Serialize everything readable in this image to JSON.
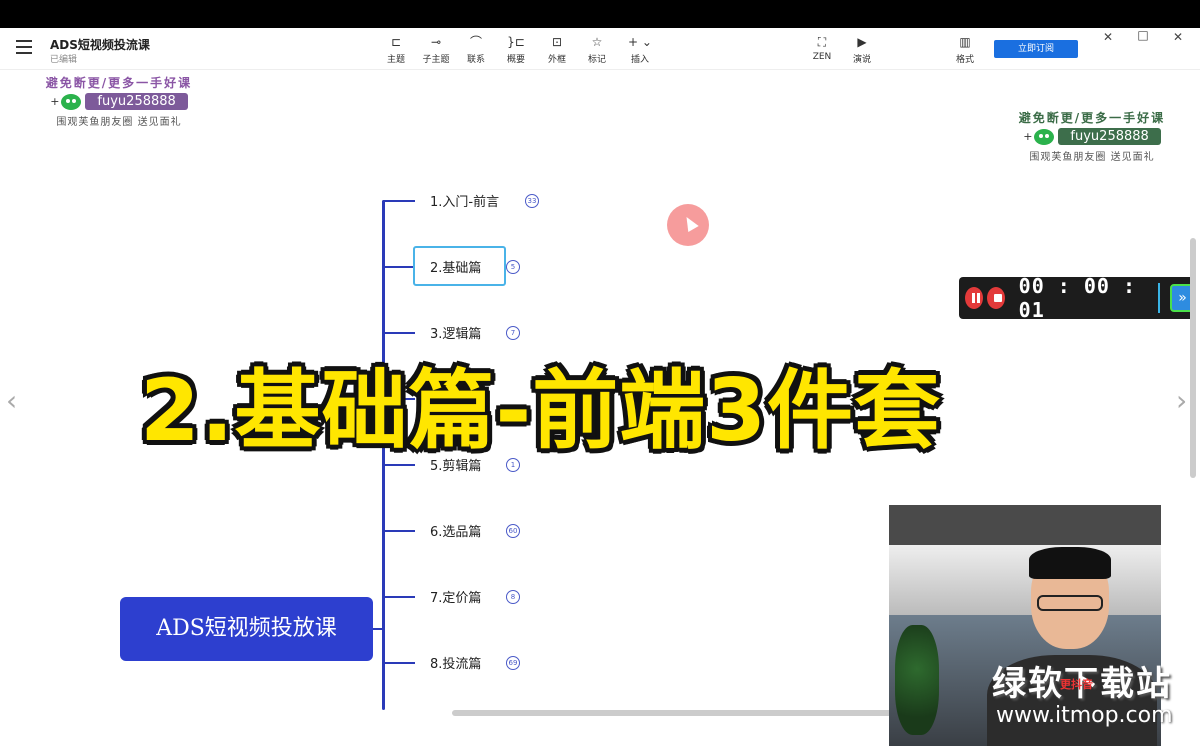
{
  "app": {
    "title": "ADS短视频投流课",
    "status": "已编辑"
  },
  "toolbar": {
    "items": [
      {
        "label": "主题",
        "icon": "topic-icon"
      },
      {
        "label": "子主题",
        "icon": "subtopic-icon"
      },
      {
        "label": "联系",
        "icon": "relation-icon"
      },
      {
        "label": "概要",
        "icon": "summary-icon"
      },
      {
        "label": "外框",
        "icon": "boundary-icon"
      },
      {
        "label": "标记",
        "icon": "marker-icon"
      },
      {
        "label": "插入",
        "icon": "insert-icon"
      },
      {
        "label": "ZEN",
        "icon": "zen-icon"
      },
      {
        "label": "演说",
        "icon": "pitch-icon"
      },
      {
        "label": "格式",
        "icon": "format-icon"
      }
    ],
    "subscribe_label": "立即订阅"
  },
  "promo": {
    "line1": "避免断更/更多一手好课",
    "wechat_prefix": "+",
    "wechat_id": "fuyu258888",
    "line3": "围观芙鱼朋友圈 送见面礼"
  },
  "mindmap": {
    "root": "ADS短视频投放课",
    "branches": [
      {
        "label": "1.入门-前言",
        "count": "33"
      },
      {
        "label": "2.基础篇",
        "count": "5"
      },
      {
        "label": "3.逻辑篇",
        "count": "7"
      },
      {
        "label": "",
        "count": ""
      },
      {
        "label": "5.剪辑篇",
        "count": "1"
      },
      {
        "label": "6.选品篇",
        "count": "60"
      },
      {
        "label": "7.定价篇",
        "count": "8"
      },
      {
        "label": "8.投流篇",
        "count": "69"
      }
    ]
  },
  "overlay": {
    "title": "2.基础篇-前端3件套"
  },
  "recorder": {
    "time": "00 : 00 : 01"
  },
  "watermark": {
    "site_name": "绿软下载站",
    "site_url": "www.itmop.com",
    "tag": "更抖音"
  }
}
